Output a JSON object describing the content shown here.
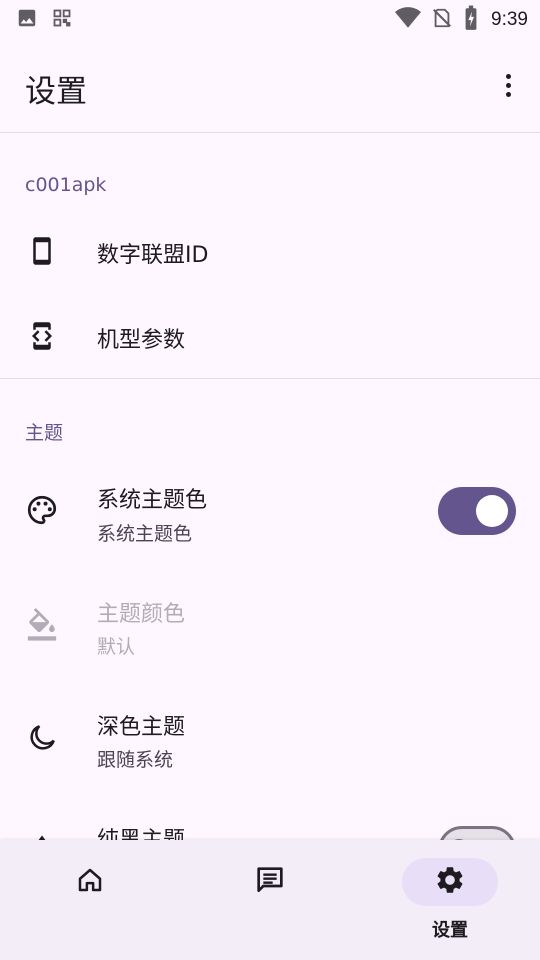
{
  "status_bar": {
    "time": "9:39"
  },
  "app_bar": {
    "title": "设置"
  },
  "sections": [
    {
      "header": "c001apk",
      "items": [
        {
          "title": "数字联盟ID",
          "icon": "phone-icon"
        },
        {
          "title": "机型参数",
          "icon": "developer-mode-icon"
        }
      ]
    },
    {
      "header": "主题",
      "items": [
        {
          "title": "系统主题色",
          "subtitle": "系统主题色",
          "icon": "palette-icon",
          "switch_on": true
        },
        {
          "title": "主题颜色",
          "subtitle": "默认",
          "icon": "format-color-fill-icon",
          "disabled": true
        },
        {
          "title": "深色主题",
          "subtitle": "跟随系统",
          "icon": "dark-mode-icon"
        },
        {
          "title": "纯黑主题",
          "icon": "contrast-icon",
          "switch_on": false
        }
      ]
    }
  ],
  "bottom_nav": [
    {
      "icon": "home-icon",
      "label": "",
      "active": false
    },
    {
      "icon": "message-icon",
      "label": "",
      "active": false
    },
    {
      "icon": "settings-icon",
      "label": "设置",
      "active": true
    }
  ],
  "colors": {
    "primary": "#65558f",
    "background": "#fef7ff",
    "nav_background": "#f3edf7",
    "active_indicator": "#e8def8"
  }
}
